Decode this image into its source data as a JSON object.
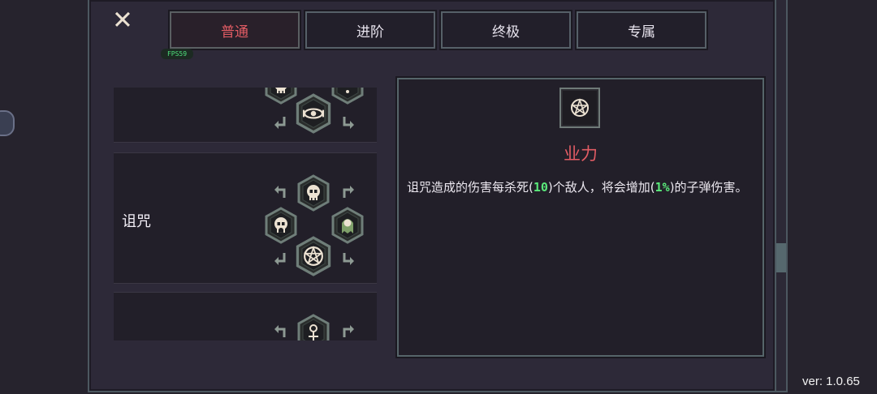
{
  "tabs": [
    {
      "label": "普通",
      "active": true
    },
    {
      "label": "进阶",
      "active": false
    },
    {
      "label": "终极",
      "active": false
    },
    {
      "label": "专属",
      "active": false
    }
  ],
  "fps_label": "FPS59",
  "close_icon": "close-x-icon",
  "skill_cards": [
    {
      "name": "",
      "icons": [
        "skull-hex-icon",
        "dots-hex-icon",
        "eye-hex-icon"
      ]
    },
    {
      "name": "诅咒",
      "icons": [
        "skull-hex-icon",
        "screaming-skull-hex-icon",
        "ghost-hex-icon",
        "pentagram-hex-icon"
      ]
    },
    {
      "name": "",
      "icons": [
        "arrow-rune-hex-icon"
      ]
    }
  ],
  "detail": {
    "icon": "pentagram-icon",
    "title": "业力",
    "desc_part1": "诅咒造成的伤害每杀死(",
    "kill_count": "10",
    "desc_part2": ")个敌人，将会增加(",
    "bonus": "1%",
    "desc_part3": ")的子弹伤害。"
  },
  "version": "ver: 1.0.65",
  "colors": {
    "accent_red": "#e25c64",
    "number_green": "#5ae87a",
    "border": "#56656a"
  }
}
